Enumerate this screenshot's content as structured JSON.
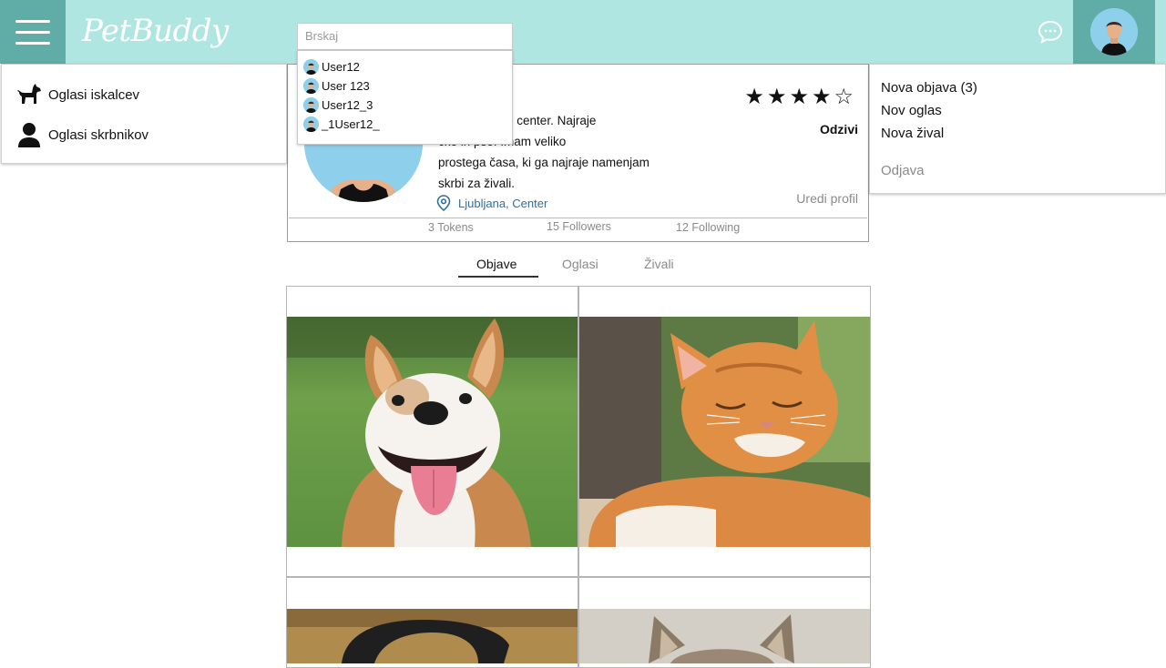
{
  "header": {
    "logo": "PetBuddy",
    "search": {
      "placeholder": "Brskaj"
    }
  },
  "search_results": [
    {
      "username": "User12"
    },
    {
      "username": "User 123"
    },
    {
      "username": "User12_3"
    },
    {
      "username": "_1User12_"
    }
  ],
  "left_menu": {
    "items": [
      {
        "label": "Oglasi iskalcev",
        "icon": "dog-icon"
      },
      {
        "label": "Oglasi skrbnikov",
        "icon": "person-icon"
      }
    ]
  },
  "right_menu": {
    "items": [
      {
        "label": "Nova objava (3)"
      },
      {
        "label": "Nov oglas"
      },
      {
        "label": "Nova žival"
      }
    ],
    "logout": "Odjava"
  },
  "profile": {
    "bio_lines": [
      "i iz Ljubljane - center. Najraje",
      "čke in pse. Imam veliko",
      "prostega časa, ki ga najraje namenjam",
      "skrbi za živali."
    ],
    "location": "Ljubljana, Center",
    "stars": "★★★★☆",
    "rating": 4,
    "rating_max": 5,
    "reviews_label": "Odzivi",
    "edit_label": "Uredi profil",
    "stats": {
      "tokens": "3 Tokens",
      "followers": "15 Followers",
      "following": "12 Following"
    }
  },
  "tabs": [
    {
      "label": "Objave",
      "active": true
    },
    {
      "label": "Oglasi",
      "active": false
    },
    {
      "label": "Živali",
      "active": false
    }
  ],
  "colors": {
    "header_bg": "#b0e6e1",
    "accent": "#5fada6",
    "location": "#2d6fa3"
  }
}
